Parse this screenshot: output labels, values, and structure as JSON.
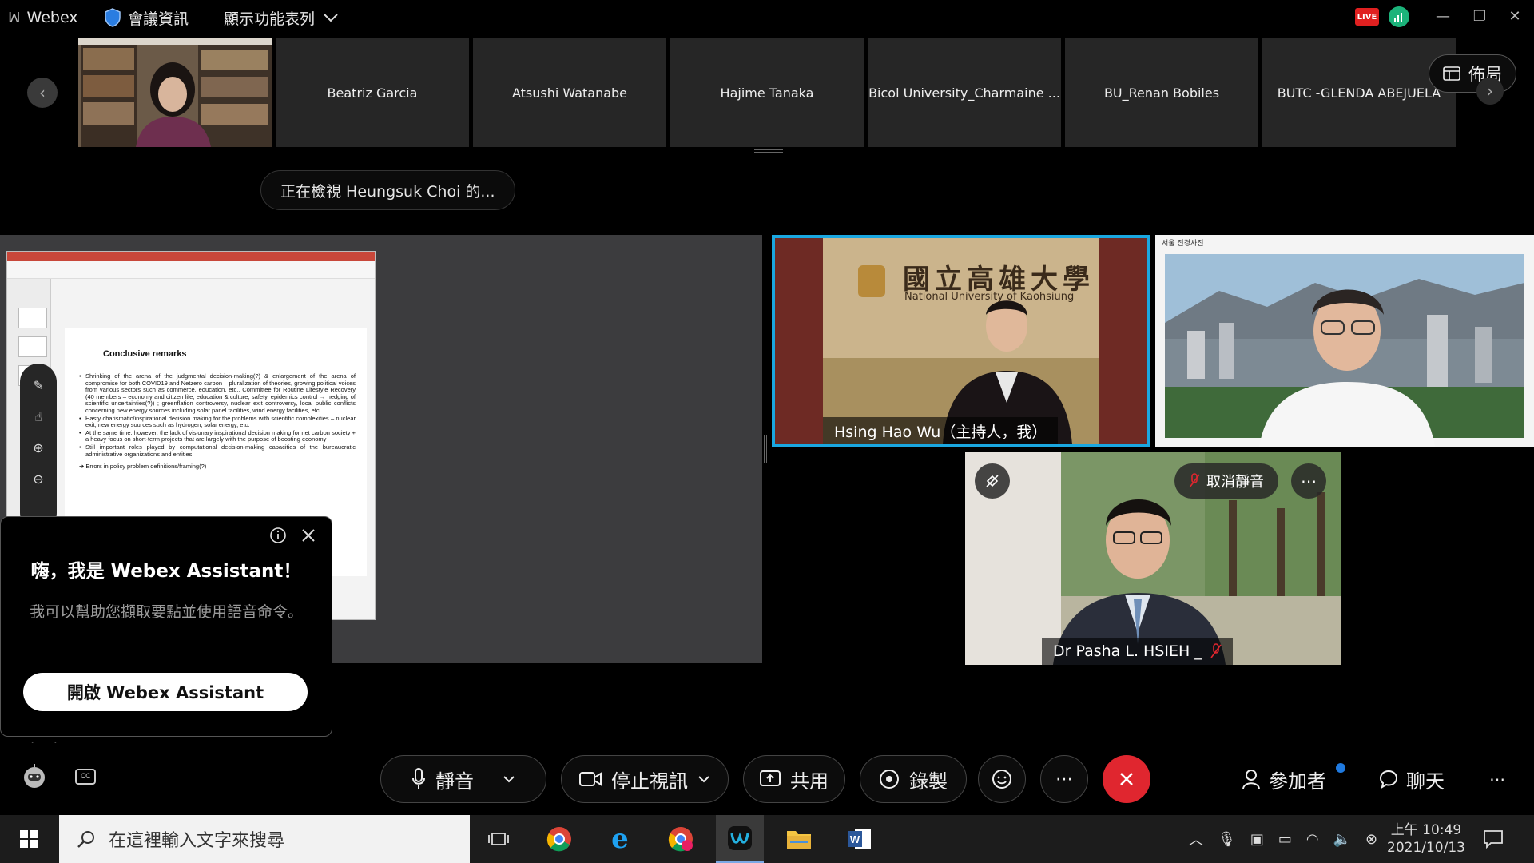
{
  "window": {
    "app_name": "Webex",
    "meeting_info": "會議資訊",
    "show_menu": "顯示功能表列",
    "live_badge": "LIVE"
  },
  "filmstrip": {
    "participants": [
      "Beatriz Garcia",
      "Atsushi Watanabe",
      "Hajime Tanaka",
      "Bicol University_Charmaine ...",
      "BU_Renan Bobiles",
      "BUTC -GLENDA ABEJUELA"
    ],
    "layout_label": "佈局"
  },
  "viewing": {
    "text": "正在檢視 Heungsuk Choi 的..."
  },
  "slide": {
    "title": "Conclusive remarks",
    "bullets": [
      "Shrinking of the arena of the judgmental decision-making(?) & enlargement of the arena of compromise for both COVID19 and Netzero carbon – pluralization of theories, growing political voices from various sectors such as commerce, education, etc., Committee for Routine Lifestyle Recovery (40 members – economy and citizen life, education & culture, safety, epidemics control → hedging of scientific uncertainties(?)) ; greenflation controversy, nuclear exit controversy, local public conflicts concerning new energy sources including solar panel facilities, wind energy facilities, etc.",
      "Hasty charismatic/inspirational decision making for the problems with scientific complexities – nuclear exit, new energy sources such as hydrogen, solar energy, etc.",
      "At the same time, however, the lack of visionary inspirational decision making for net carbon society + a heavy focus on short-term projects that are largely with the purpose of boosting economy",
      "Still important roles played by computational decision-making capacities of the bureaucratic administrative organizations and entities"
    ],
    "arrow_line": "➔ Errors in policy problem definitions/framing(?)"
  },
  "assistant": {
    "title": "嗨，我是 Webex Assistant！",
    "description": "我可以幫助您擷取要點並使用語音命令。",
    "enable_button": "開啟 Webex Assistant"
  },
  "videos": {
    "host": {
      "name": "Hsing Hao Wu（主持人，我）",
      "banner_cn": "國立高雄大學",
      "banner_en": "National University of Kaohsiung"
    },
    "seoul": {
      "caption": "서울 전경사진"
    },
    "pasha": {
      "name": "Dr Pasha L. HSIEH _",
      "unmute_label": "取消靜音"
    }
  },
  "controls": {
    "mute": "靜音",
    "stop_video": "停止視訊",
    "share": "共用",
    "record": "錄製",
    "participants": "參加者",
    "chat": "聊天"
  },
  "taskbar": {
    "search_placeholder": "在這裡輸入文字來搜尋",
    "time": "上午 10:49",
    "date": "2021/10/13"
  },
  "colors": {
    "active_speaker_border": "#1aa7e0",
    "end_call": "#e0262f",
    "live_badge": "#e02020"
  }
}
